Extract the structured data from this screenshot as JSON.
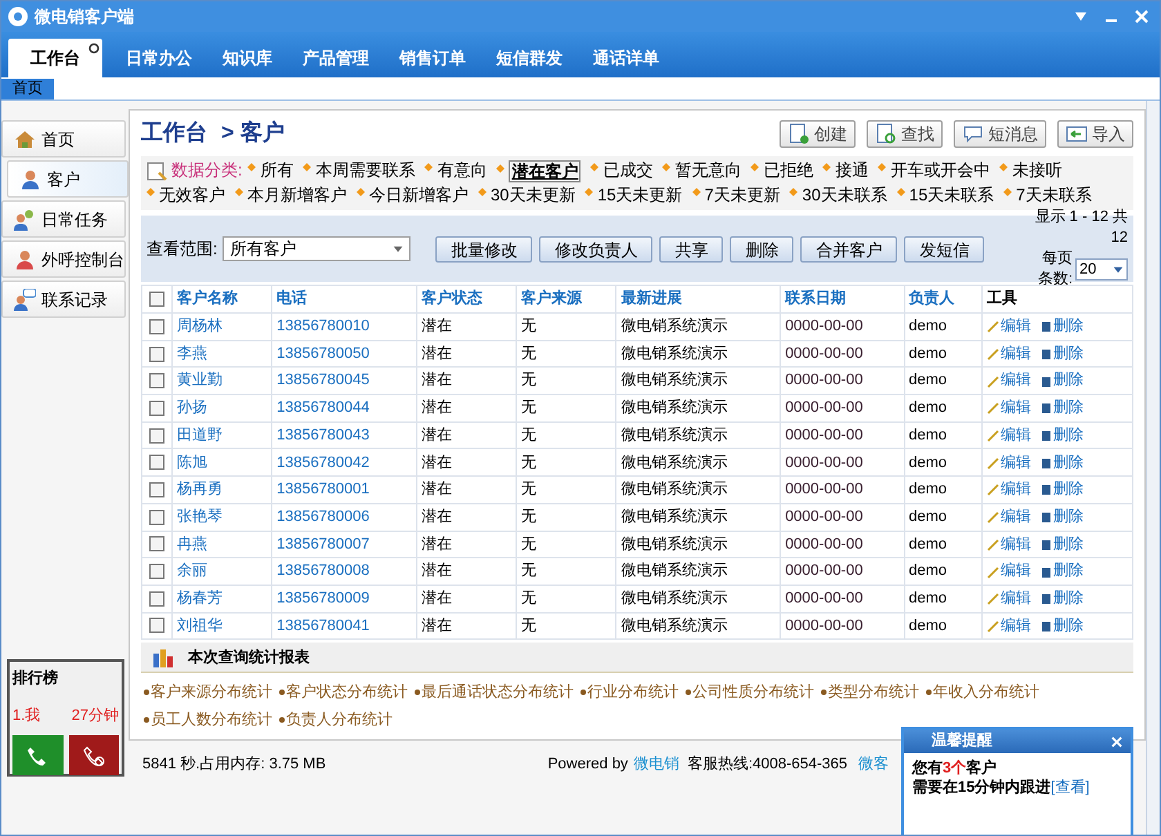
{
  "window": {
    "title": "微电销客户端"
  },
  "tabs": [
    {
      "label": "工作台",
      "selected": true
    },
    {
      "label": "日常办公",
      "selected": false
    },
    {
      "label": "知识库",
      "selected": false
    },
    {
      "label": "产品管理",
      "selected": false
    },
    {
      "label": "销售订单",
      "selected": false
    },
    {
      "label": "短信群发",
      "selected": false
    },
    {
      "label": "通话详单",
      "selected": false
    }
  ],
  "page_tabs": [
    {
      "label": "首页",
      "selected": true
    }
  ],
  "sidebar": {
    "items": [
      {
        "label": "首页",
        "selected": false
      },
      {
        "label": "客户",
        "selected": true
      },
      {
        "label": "日常任务",
        "selected": false
      },
      {
        "label": "外呼控制台",
        "selected": false
      },
      {
        "label": "联系记录",
        "selected": false
      }
    ]
  },
  "breadcrumb": [
    "工作台",
    "> 客户"
  ],
  "toolbar": [
    {
      "label": "创建"
    },
    {
      "label": "查找"
    },
    {
      "label": "短消息"
    },
    {
      "label": "导入"
    }
  ],
  "categories": {
    "label": "数据分类:",
    "items": [
      {
        "label": "所有",
        "selected": false
      },
      {
        "label": "本周需要联系",
        "selected": false
      },
      {
        "label": "有意向",
        "selected": false
      },
      {
        "label": "潜在客户",
        "selected": true
      },
      {
        "label": "已成交",
        "selected": false
      },
      {
        "label": "暂无意向",
        "selected": false
      },
      {
        "label": "已拒绝",
        "selected": false
      },
      {
        "label": "接通",
        "selected": false
      },
      {
        "label": "开车或开会中",
        "selected": false
      },
      {
        "label": "未接听",
        "selected": false
      },
      {
        "label": "无效客户",
        "selected": false
      },
      {
        "label": "本月新增客户",
        "selected": false
      },
      {
        "label": "今日新增客户",
        "selected": false
      },
      {
        "label": "30天未更新",
        "selected": false
      },
      {
        "label": "15天未更新",
        "selected": false
      },
      {
        "label": "7天未更新",
        "selected": false
      },
      {
        "label": "30天未联系",
        "selected": false
      },
      {
        "label": "15天未联系",
        "selected": false
      },
      {
        "label": "7天未联系",
        "selected": false
      }
    ]
  },
  "filter": {
    "label": "查看范围:",
    "value": "所有客户",
    "actions": [
      "批量修改",
      "修改负责人",
      "共享",
      "删除",
      "合并客户",
      "发短信"
    ],
    "paging": "显示 1 - 12 共 12",
    "per_page_label": "每页条数:",
    "per_page": "20"
  },
  "table": {
    "select_all_checked": false,
    "columns": [
      "客户名称",
      "电话",
      "客户状态",
      "客户来源",
      "最新进展",
      "联系日期",
      "负责人",
      "工具"
    ],
    "rows": [
      {
        "checked": false,
        "cells": [
          "周杨林",
          "13856780010",
          "潜在",
          "无",
          "微电销系统演示",
          "0000-00-00",
          "demo"
        ],
        "edit": "编辑",
        "delete": "删除"
      },
      {
        "checked": false,
        "cells": [
          "李燕",
          "13856780050",
          "潜在",
          "无",
          "微电销系统演示",
          "0000-00-00",
          "demo"
        ],
        "edit": "编辑",
        "delete": "删除"
      },
      {
        "checked": false,
        "cells": [
          "黄业勤",
          "13856780045",
          "潜在",
          "无",
          "微电销系统演示",
          "0000-00-00",
          "demo"
        ],
        "edit": "编辑",
        "delete": "删除"
      },
      {
        "checked": false,
        "cells": [
          "孙扬",
          "13856780044",
          "潜在",
          "无",
          "微电销系统演示",
          "0000-00-00",
          "demo"
        ],
        "edit": "编辑",
        "delete": "删除"
      },
      {
        "checked": false,
        "cells": [
          "田道野",
          "13856780043",
          "潜在",
          "无",
          "微电销系统演示",
          "0000-00-00",
          "demo"
        ],
        "edit": "编辑",
        "delete": "删除"
      },
      {
        "checked": false,
        "cells": [
          "陈旭",
          "13856780042",
          "潜在",
          "无",
          "微电销系统演示",
          "0000-00-00",
          "demo"
        ],
        "edit": "编辑",
        "delete": "删除"
      },
      {
        "checked": false,
        "cells": [
          "杨再勇",
          "13856780001",
          "潜在",
          "无",
          "微电销系统演示",
          "0000-00-00",
          "demo"
        ],
        "edit": "编辑",
        "delete": "删除"
      },
      {
        "checked": false,
        "cells": [
          "张艳琴",
          "13856780006",
          "潜在",
          "无",
          "微电销系统演示",
          "0000-00-00",
          "demo"
        ],
        "edit": "编辑",
        "delete": "删除"
      },
      {
        "checked": false,
        "cells": [
          "冉燕",
          "13856780007",
          "潜在",
          "无",
          "微电销系统演示",
          "0000-00-00",
          "demo"
        ],
        "edit": "编辑",
        "delete": "删除"
      },
      {
        "checked": false,
        "cells": [
          "余丽",
          "13856780008",
          "潜在",
          "无",
          "微电销系统演示",
          "0000-00-00",
          "demo"
        ],
        "edit": "编辑",
        "delete": "删除"
      },
      {
        "checked": false,
        "cells": [
          "杨春芳",
          "13856780009",
          "潜在",
          "无",
          "微电销系统演示",
          "0000-00-00",
          "demo"
        ],
        "edit": "编辑",
        "delete": "删除"
      },
      {
        "checked": false,
        "cells": [
          "刘祖华",
          "13856780041",
          "潜在",
          "无",
          "微电销系统演示",
          "0000-00-00",
          "demo"
        ],
        "edit": "编辑",
        "delete": "删除"
      }
    ]
  },
  "report": {
    "title": "本次查询统计报表",
    "links": [
      "客户来源分布统计",
      "客户状态分布统计",
      "最后通话状态分布统计",
      "行业分布统计",
      "公司性质分布统计",
      "类型分布统计",
      "年收入分布统计",
      "员工人数分布统计",
      "负责人分布统计"
    ]
  },
  "status_bar": {
    "usage": "5841 秒.占用内存: 3.75 MB",
    "powered_by": "Powered by",
    "brand": "微电销",
    "hotline": "客服热线:4008-654-365",
    "site": "微客"
  },
  "ranking": {
    "title": "排行榜",
    "entry": "1.我",
    "time": "27分钟"
  },
  "reminder": {
    "title": "温馨提醒",
    "before": "您有",
    "count": "3个",
    "after": "客户",
    "line2": "需要在15分钟内跟进",
    "link": "[查看]"
  }
}
